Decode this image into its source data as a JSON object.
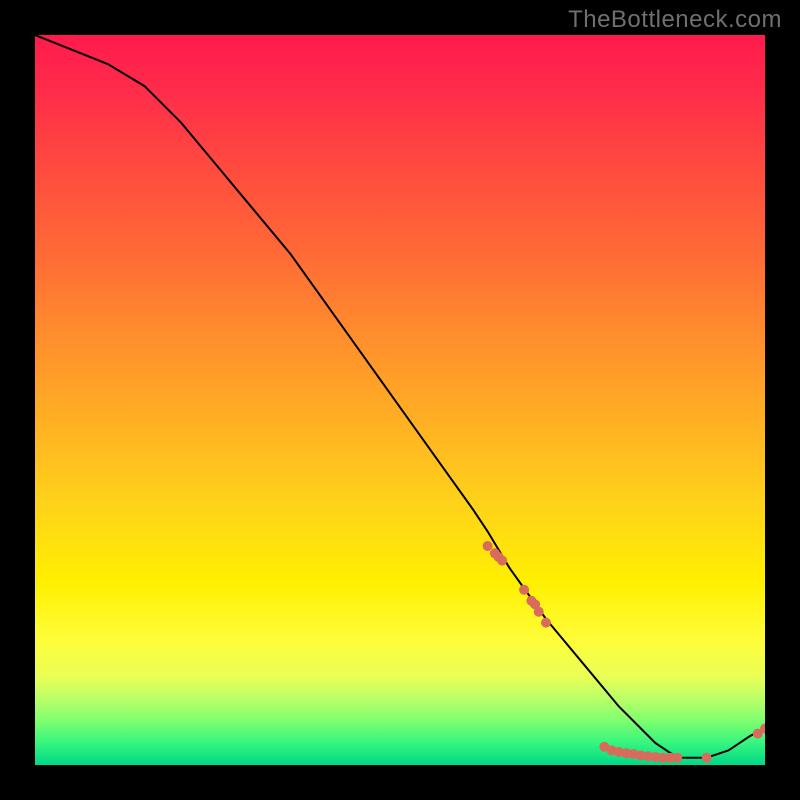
{
  "watermark": "TheBottleneck.com",
  "chart_data": {
    "type": "line",
    "title": "",
    "xlabel": "",
    "ylabel": "",
    "xlim": [
      0,
      100
    ],
    "ylim": [
      0,
      100
    ],
    "series": [
      {
        "name": "curve",
        "color": "#000000",
        "x": [
          0,
          5,
          10,
          15,
          20,
          25,
          30,
          35,
          40,
          45,
          50,
          55,
          60,
          62,
          65,
          70,
          75,
          80,
          83,
          85,
          88,
          90,
          92,
          95,
          98,
          100
        ],
        "y": [
          100,
          98,
          96,
          93,
          88,
          82,
          76,
          70,
          63,
          56,
          49,
          42,
          35,
          32,
          27,
          20,
          14,
          8,
          5,
          3,
          1,
          1,
          1,
          2,
          4,
          5
        ]
      }
    ],
    "scatter": [
      {
        "name": "cluster-diagonal",
        "color": "#d96b5c",
        "x": [
          62,
          63,
          63.5,
          64,
          67,
          68,
          68.5,
          69,
          70
        ],
        "y": [
          30,
          29,
          28.5,
          28,
          24,
          22.5,
          22,
          21,
          19.5
        ]
      },
      {
        "name": "cluster-bottom",
        "color": "#d96b5c",
        "x": [
          78,
          79,
          80,
          81,
          82,
          83,
          84,
          85,
          86,
          87,
          88,
          92,
          99,
          100
        ],
        "y": [
          2.5,
          2,
          1.8,
          1.6,
          1.5,
          1.3,
          1.2,
          1.1,
          1.0,
          1.0,
          1.0,
          1.0,
          4.3,
          5
        ]
      }
    ],
    "gradient_stops": [
      {
        "pos": 0,
        "color": "#ff1a4d"
      },
      {
        "pos": 8,
        "color": "#ff2d4a"
      },
      {
        "pos": 18,
        "color": "#ff4a3f"
      },
      {
        "pos": 30,
        "color": "#ff6a36"
      },
      {
        "pos": 40,
        "color": "#ff8a2e"
      },
      {
        "pos": 52,
        "color": "#ffad24"
      },
      {
        "pos": 64,
        "color": "#ffd21a"
      },
      {
        "pos": 75,
        "color": "#fff000"
      },
      {
        "pos": 83,
        "color": "#fffd3a"
      },
      {
        "pos": 88,
        "color": "#e8ff55"
      },
      {
        "pos": 91,
        "color": "#b8ff68"
      },
      {
        "pos": 94,
        "color": "#7dff6f"
      },
      {
        "pos": 97,
        "color": "#35f57e"
      },
      {
        "pos": 100,
        "color": "#00d887"
      }
    ]
  }
}
